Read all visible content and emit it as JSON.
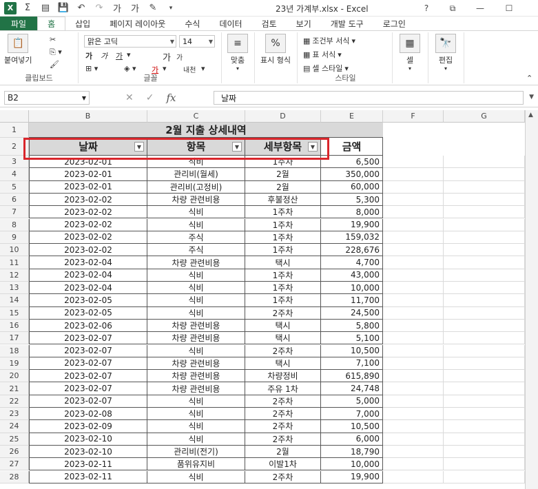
{
  "titlebar": {
    "title": "23년 가계부.xlsx - Excel",
    "excel_badge": "X",
    "sum_symbol": "Σ",
    "help": "?",
    "restore": "⧉",
    "minimize": "—",
    "maximize": "☐"
  },
  "tabs": [
    "파일",
    "홈",
    "삽입",
    "페이지 레이아웃",
    "수식",
    "데이터",
    "검토",
    "보기",
    "개발 도구",
    "로그인"
  ],
  "ribbon": {
    "paste_label": "붙여넣기",
    "clipboard_label": "클립보드",
    "font_name": "맑은 고딕",
    "font_size": "14",
    "font_label": "글꼴",
    "align_label": "맞춤",
    "number_label": "표시 형식",
    "number_icon": "%",
    "cond_format": "조건부 서식",
    "table_format": "표 서식",
    "cell_style": "셀 스타일",
    "style_label": "스타일",
    "cells_label": "셀",
    "edit_label": "편집",
    "bold": "가",
    "italic": "가",
    "underline": "가",
    "grow_font": "가",
    "shrink_font": "가",
    "font_color": "가",
    "phonetic": "내천"
  },
  "formula_bar": {
    "name_box": "B2",
    "formula": "날짜",
    "fx": "fx",
    "cancel": "✕",
    "enter": "✓"
  },
  "sheet": {
    "columns": [
      "B",
      "C",
      "D",
      "E",
      "F",
      "G"
    ],
    "title": "2월 지출 상세내역",
    "headers": [
      "날짜",
      "항목",
      "세부항목",
      "금액"
    ],
    "rows": [
      {
        "num": "3",
        "date": "2023-02-01",
        "item": "식비",
        "detail": "1주차",
        "amount": "6,500"
      },
      {
        "num": "4",
        "date": "2023-02-01",
        "item": "관리비(월세)",
        "detail": "2월",
        "amount": "350,000"
      },
      {
        "num": "5",
        "date": "2023-02-01",
        "item": "관리비(고정비)",
        "detail": "2월",
        "amount": "60,000"
      },
      {
        "num": "6",
        "date": "2023-02-02",
        "item": "차량 관련비용",
        "detail": "후불정산",
        "amount": "5,300"
      },
      {
        "num": "7",
        "date": "2023-02-02",
        "item": "식비",
        "detail": "1주차",
        "amount": "8,000"
      },
      {
        "num": "8",
        "date": "2023-02-02",
        "item": "식비",
        "detail": "1주차",
        "amount": "19,900"
      },
      {
        "num": "9",
        "date": "2023-02-02",
        "item": "주식",
        "detail": "1주차",
        "amount": "159,032"
      },
      {
        "num": "10",
        "date": "2023-02-02",
        "item": "주식",
        "detail": "1주차",
        "amount": "228,676"
      },
      {
        "num": "11",
        "date": "2023-02-04",
        "item": "차량 관련비용",
        "detail": "택시",
        "amount": "4,700"
      },
      {
        "num": "12",
        "date": "2023-02-04",
        "item": "식비",
        "detail": "1주차",
        "amount": "43,000"
      },
      {
        "num": "13",
        "date": "2023-02-04",
        "item": "식비",
        "detail": "1주차",
        "amount": "10,000"
      },
      {
        "num": "14",
        "date": "2023-02-05",
        "item": "식비",
        "detail": "1주차",
        "amount": "11,700"
      },
      {
        "num": "15",
        "date": "2023-02-05",
        "item": "식비",
        "detail": "2주차",
        "amount": "24,500"
      },
      {
        "num": "16",
        "date": "2023-02-06",
        "item": "차량 관련비용",
        "detail": "택시",
        "amount": "5,800"
      },
      {
        "num": "17",
        "date": "2023-02-07",
        "item": "차량 관련비용",
        "detail": "택시",
        "amount": "5,100"
      },
      {
        "num": "18",
        "date": "2023-02-07",
        "item": "식비",
        "detail": "2주차",
        "amount": "10,500"
      },
      {
        "num": "19",
        "date": "2023-02-07",
        "item": "차량 관련비용",
        "detail": "택시",
        "amount": "7,100"
      },
      {
        "num": "20",
        "date": "2023-02-07",
        "item": "차량 관련비용",
        "detail": "차량정비",
        "amount": "615,890"
      },
      {
        "num": "21",
        "date": "2023-02-07",
        "item": "차량 관련비용",
        "detail": "주유 1차",
        "amount": "24,748"
      },
      {
        "num": "22",
        "date": "2023-02-07",
        "item": "식비",
        "detail": "2주차",
        "amount": "5,000"
      },
      {
        "num": "23",
        "date": "2023-02-08",
        "item": "식비",
        "detail": "2주차",
        "amount": "7,000"
      },
      {
        "num": "24",
        "date": "2023-02-09",
        "item": "식비",
        "detail": "2주차",
        "amount": "10,500"
      },
      {
        "num": "25",
        "date": "2023-02-10",
        "item": "식비",
        "detail": "2주차",
        "amount": "6,000"
      },
      {
        "num": "26",
        "date": "2023-02-10",
        "item": "관리비(전기)",
        "detail": "2월",
        "amount": "18,790"
      },
      {
        "num": "27",
        "date": "2023-02-11",
        "item": "품위유지비",
        "detail": "이발1차",
        "amount": "10,000"
      },
      {
        "num": "28",
        "date": "2023-02-11",
        "item": "식비",
        "detail": "2주차",
        "amount": "19,900"
      }
    ]
  },
  "colors": {
    "excel_green": "#217346",
    "header_fill": "#d9d9d9",
    "highlight_red": "#d9262c"
  }
}
